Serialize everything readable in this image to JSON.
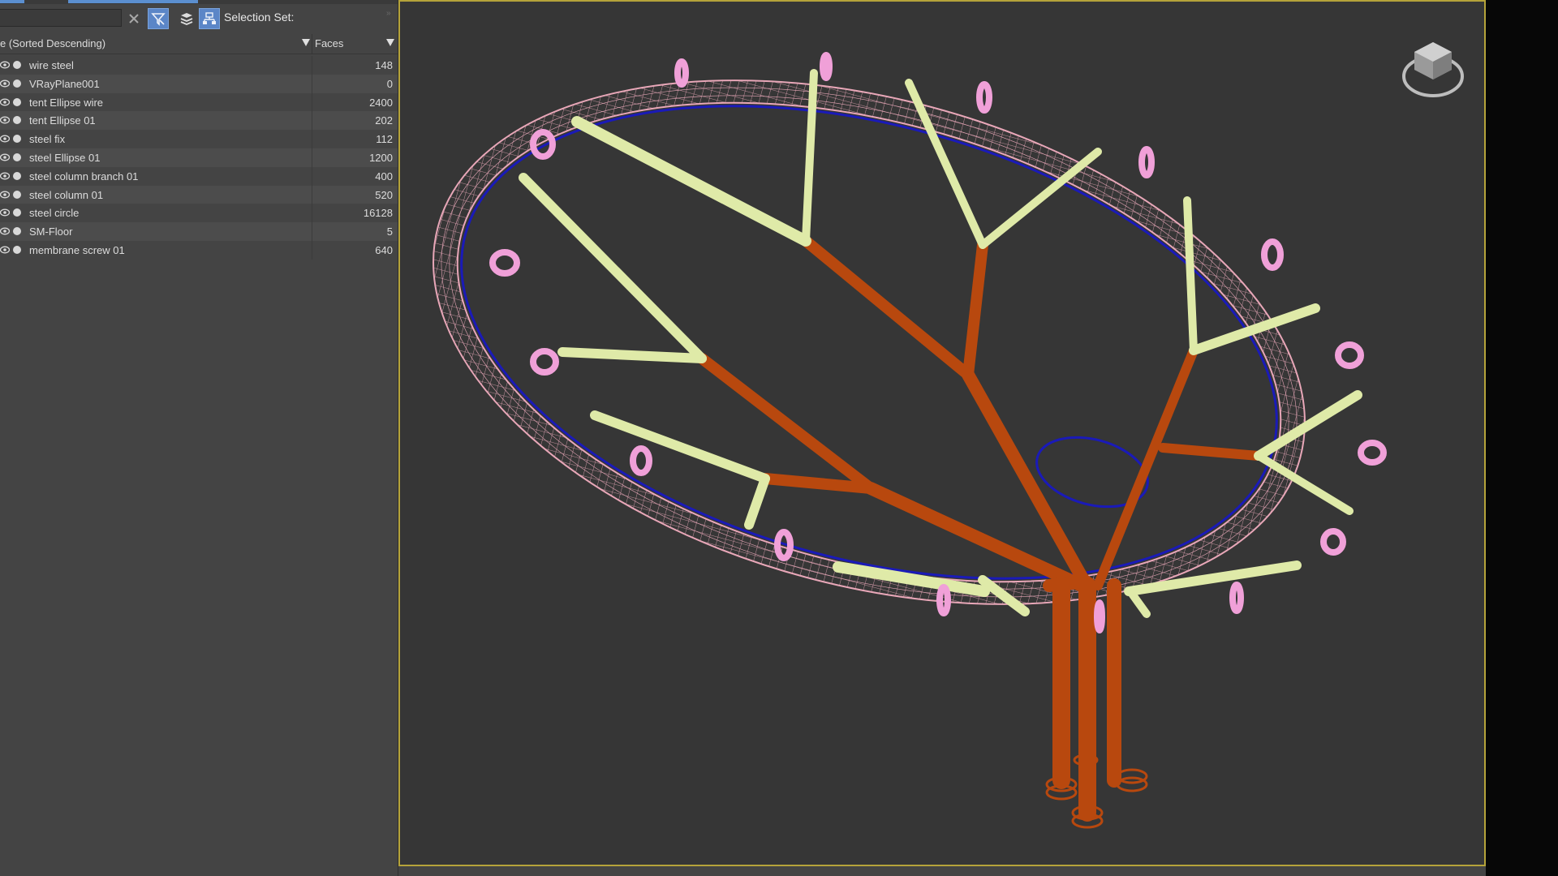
{
  "toolbar": {
    "search_value": "",
    "selection_set_label": "Selection Set:",
    "icons": [
      "close-icon",
      "filter-icon",
      "layers-icon",
      "hierarchy-icon"
    ]
  },
  "columns": {
    "name_header": "e (Sorted Descending)",
    "faces_header": "Faces"
  },
  "objects": [
    {
      "name": "wire steel",
      "faces": "148"
    },
    {
      "name": "VRayPlane001",
      "faces": "0"
    },
    {
      "name": "tent Ellipse wire",
      "faces": "2400"
    },
    {
      "name": "tent Ellipse 01",
      "faces": "202"
    },
    {
      "name": "steel fix",
      "faces": "112"
    },
    {
      "name": "steel Ellipse 01",
      "faces": "1200"
    },
    {
      "name": "steel column branch 01",
      "faces": "400"
    },
    {
      "name": "steel column 01",
      "faces": "520"
    },
    {
      "name": "steel circle",
      "faces": "16128"
    },
    {
      "name": "SM-Floor",
      "faces": "5"
    },
    {
      "name": "membrane screw 01",
      "faces": "640"
    }
  ],
  "colors": {
    "accent": "#5b86c7",
    "viewport_border": "#b5a33a",
    "ring_mesh": "#e8a7b8",
    "ellipse": "#1a1ab8",
    "branch": "#b8480e",
    "strut": "#dfeaa8",
    "clamp": "#f0a0d8"
  }
}
